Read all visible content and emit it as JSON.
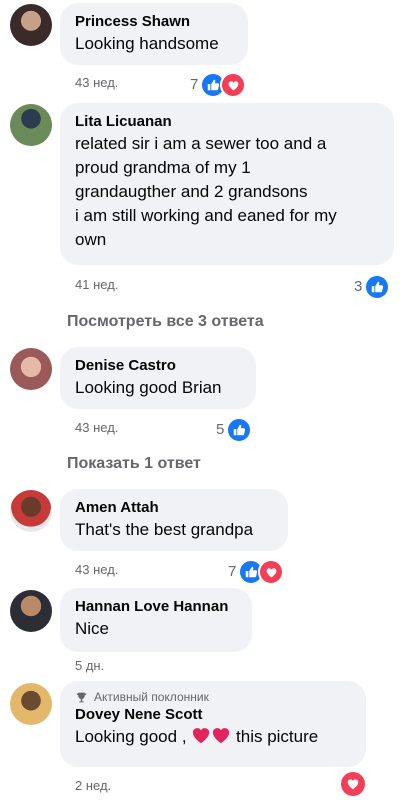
{
  "comments": [
    {
      "author": "Princess Shawn",
      "text": "Looking handsome",
      "time": "43 нед.",
      "reactions": "7"
    },
    {
      "author": "Lita Licuanan",
      "text_lines": [
        "related sir i am a sewer too and a",
        "proud grandma of my 1",
        "grandaugther and 2 grandsons",
        "i am still working and eaned for my",
        "own"
      ],
      "time": "41 нед.",
      "reactions": "3"
    },
    {
      "author": "Denise Castro",
      "text": "Looking good Brian",
      "time": "43 нед.",
      "reactions": "5"
    },
    {
      "author": "Amen Attah",
      "text": "That's the best grandpa",
      "time": "43 нед.",
      "reactions": "7"
    },
    {
      "author": "Hannan Love Hannan",
      "text": "Nice",
      "time": "5 дн."
    },
    {
      "author": "Dovey Nene Scott",
      "badge": "Активный поклонник",
      "text_before": "Looking good ,",
      "text_after": "this picture",
      "time": "2 нед."
    }
  ],
  "view_all_replies": "Посмотреть все 3 ответа",
  "show_reply": "Показать 1 ответ",
  "colors": {
    "like": "#1877f2",
    "love": "#f33e58",
    "bubble": "#f0f2f5",
    "meta": "#65676b"
  }
}
